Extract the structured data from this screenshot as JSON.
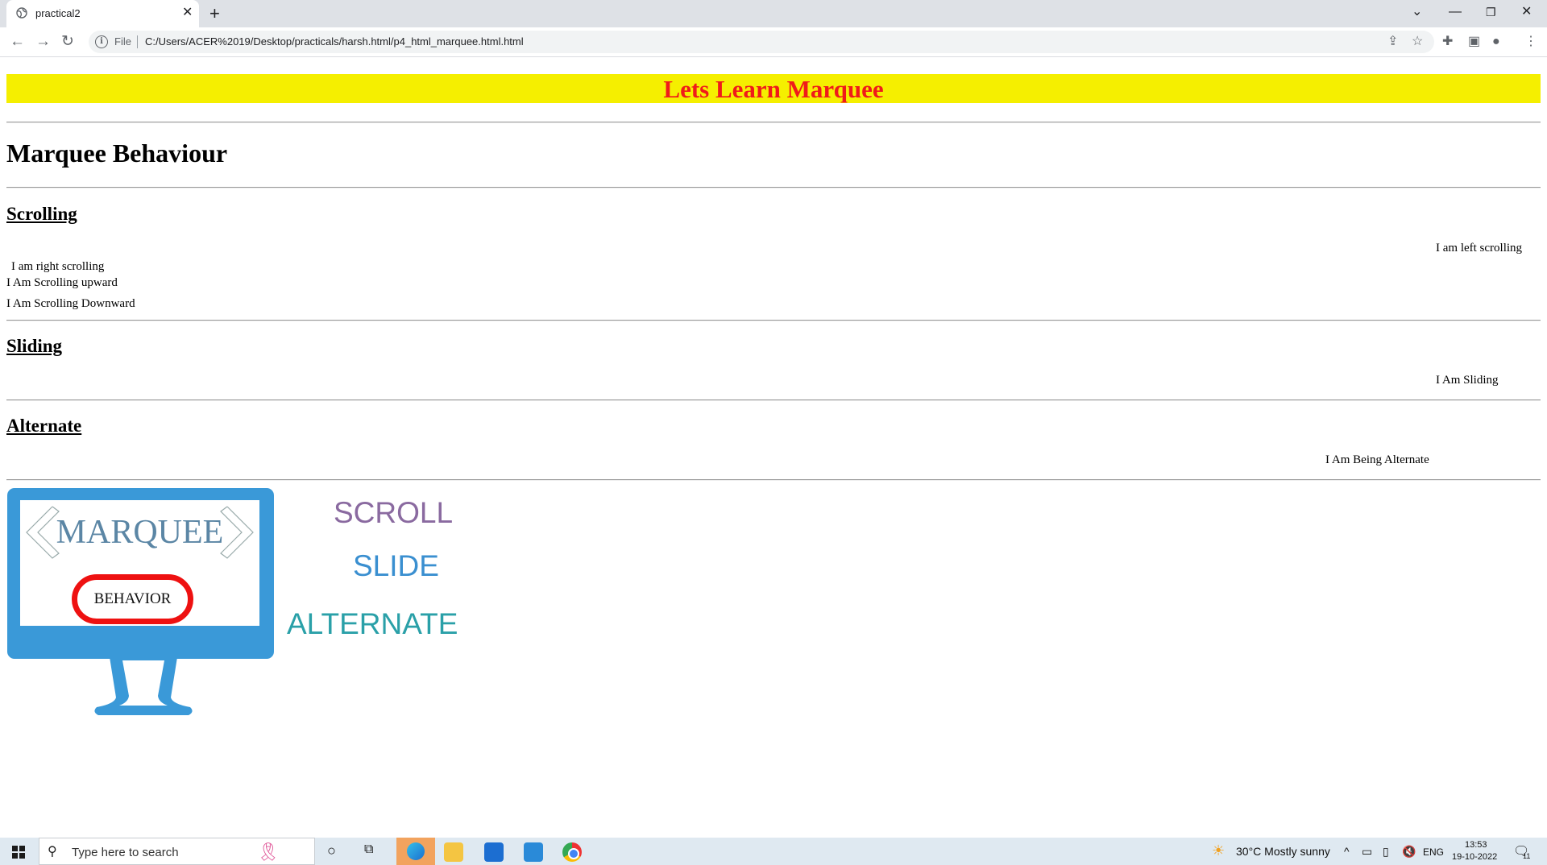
{
  "browser": {
    "tab_title": "practical2",
    "tab_close": "✕",
    "new_tab": "+",
    "file_label": "File",
    "url": "C:/Users/ACER%2019/Desktop/practicals/harsh.html/p4_html_marquee.html.html"
  },
  "page": {
    "banner": "Lets Learn Marquee",
    "heading": "Marquee Behaviour",
    "sections": [
      {
        "title": "Scrolling",
        "items": [
          "I am left scrolling",
          "I am right scrolling",
          "I Am Scrolling upward",
          "I Am Scrolling Downward"
        ]
      },
      {
        "title": "Sliding",
        "items": [
          "I Am Sliding"
        ]
      },
      {
        "title": "Alternate",
        "items": [
          "I Am Being Alternate"
        ]
      }
    ],
    "illustration": {
      "screen_word": "MARQUEE",
      "pill_label": "BEHAVIOR",
      "words": [
        "SCROLL",
        "SLIDE",
        "ALTERNATE"
      ],
      "colors": {
        "frame": "#3a99d8",
        "scroll": "#8a6aa0",
        "slide": "#3a8fd0",
        "alternate": "#2aa0a8",
        "pill": "#e11111"
      }
    }
  },
  "taskbar": {
    "search_placeholder": "Type here to search",
    "weather": "30°C  Mostly sunny",
    "lang": "ENG",
    "time": "13:53",
    "date": "19-10-2022",
    "notifications": "11"
  }
}
